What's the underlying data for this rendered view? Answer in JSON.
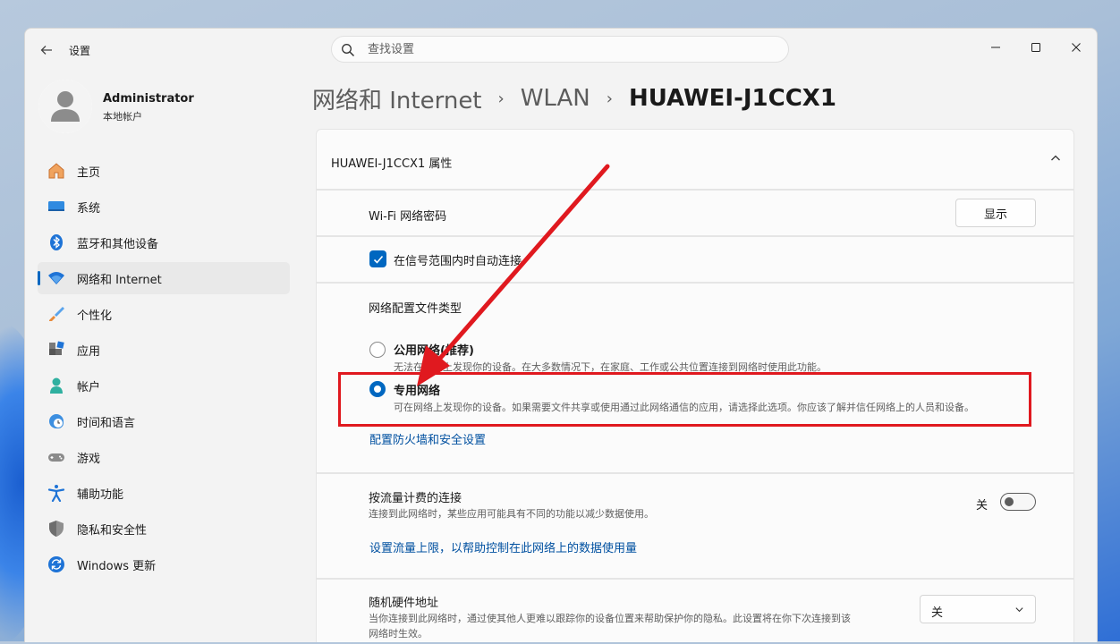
{
  "titlebar": {
    "app_title": "设置",
    "search_placeholder": "查找设置"
  },
  "profile": {
    "name": "Administrator",
    "account_type": "本地帐户"
  },
  "nav": {
    "items": [
      {
        "label": "主页",
        "icon": "home-icon"
      },
      {
        "label": "系统",
        "icon": "system-icon"
      },
      {
        "label": "蓝牙和其他设备",
        "icon": "bluetooth-icon"
      },
      {
        "label": "网络和 Internet",
        "icon": "wifi-icon",
        "active": true
      },
      {
        "label": "个性化",
        "icon": "brush-icon"
      },
      {
        "label": "应用",
        "icon": "apps-icon"
      },
      {
        "label": "帐户",
        "icon": "account-icon"
      },
      {
        "label": "时间和语言",
        "icon": "clock-globe-icon"
      },
      {
        "label": "游戏",
        "icon": "gamepad-icon"
      },
      {
        "label": "辅助功能",
        "icon": "accessibility-icon"
      },
      {
        "label": "隐私和安全性",
        "icon": "shield-icon"
      },
      {
        "label": "Windows 更新",
        "icon": "update-icon"
      }
    ]
  },
  "breadcrumb": {
    "parts": [
      "网络和 Internet",
      "WLAN"
    ],
    "current": "HUAWEI-J1CCX1"
  },
  "properties": {
    "header": "HUAWEI-J1CCX1 属性",
    "wifi_password_label": "Wi-Fi 网络密码",
    "show_button": "显示",
    "auto_connect_label": "在信号范围内时自动连接",
    "auto_connect_checked": true,
    "profile_type_label": "网络配置文件类型",
    "public_title": "公用网络(推荐)",
    "public_desc": "无法在网络上发现你的设备。在大多数情况下，在家庭、工作或公共位置连接到网络时使用此功能。",
    "private_title": "专用网络",
    "private_desc": "可在网络上发现你的设备。如果需要文件共享或使用通过此网络通信的应用，请选择此选项。你应该了解并信任网络上的人员和设备。",
    "selected_profile": "private",
    "firewall_link": "配置防火墙和安全设置"
  },
  "metered": {
    "title": "按流量计费的连接",
    "desc": "连接到此网络时，某些应用可能具有不同的功能以减少数据使用。",
    "toggle_state": "关",
    "data_limit_link": "设置流量上限，以帮助控制在此网络上的数据使用量"
  },
  "random_hw": {
    "title": "随机硬件地址",
    "desc_line1": "当你连接到此网络时，通过使其他人更难以跟踪你的设备位置来帮助保护你的隐私。此设置将在你下次连接到该",
    "desc_line2": "网络时生效。",
    "select_value": "关"
  },
  "colors": {
    "accent": "#0067c0",
    "annotation": "#e0191f",
    "link": "#0050a0"
  }
}
